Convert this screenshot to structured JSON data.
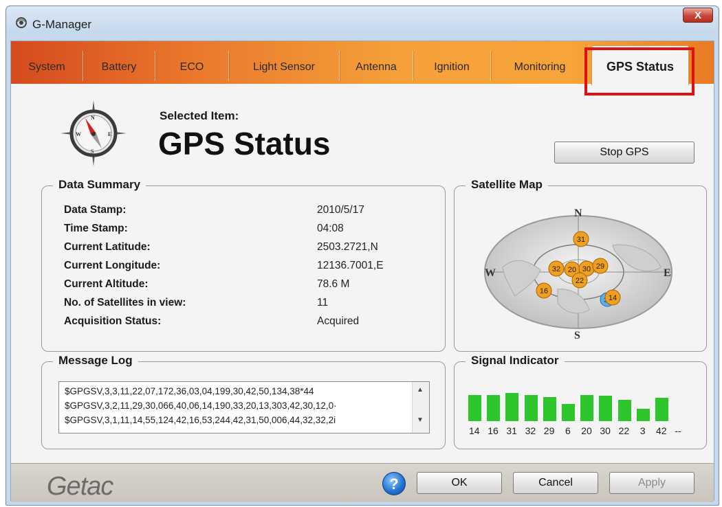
{
  "window": {
    "title": "G-Manager",
    "close_label": "X"
  },
  "tabs": [
    "System",
    "Battery",
    "ECO",
    "Light Sensor",
    "Antenna",
    "Ignition",
    "Monitoring",
    "GPS Status"
  ],
  "active_tab": "GPS Status",
  "header": {
    "selected_label": "Selected Item:",
    "title": "GPS Status",
    "stop_button": "Stop GPS"
  },
  "data_summary": {
    "title": "Data Summary",
    "rows": [
      {
        "label": "Data Stamp:",
        "value": "2010/5/17"
      },
      {
        "label": "Time Stamp:",
        "value": "04:08"
      },
      {
        "label": "Current Latitude:",
        "value": "2503.2721,N"
      },
      {
        "label": "Current Longitude:",
        "value": "12136.7001,E"
      },
      {
        "label": "Current Altitude:",
        "value": "78.6 M"
      },
      {
        "label": "No. of Satellites in view:",
        "value": "11"
      },
      {
        "label": "Acquisition Status:",
        "value": "Acquired"
      }
    ]
  },
  "satellite_map": {
    "title": "Satellite Map",
    "directions": {
      "n": "N",
      "s": "S",
      "e": "E",
      "w": "W"
    },
    "satellites": [
      "31",
      "32",
      "20",
      "30",
      "29",
      "22",
      "16",
      "14",
      "3"
    ]
  },
  "message_log": {
    "title": "Message Log",
    "lines": [
      "$GPGSV,3,3,11,22,07,172,36,03,04,199,30,42,50,134,38*44",
      "$GPGSV,3,2,11,29,30,066,40,06,14,190,33,20,13,303,42,30,12,0·",
      "$GPGSV,3,1,11,14,55,124,42,16,53,244,42,31,50,006,44,32,32,2i"
    ]
  },
  "signal_indicator": {
    "title": "Signal Indicator",
    "bars": [
      {
        "label": "14",
        "level": 0.8
      },
      {
        "label": "16",
        "level": 0.8
      },
      {
        "label": "31",
        "level": 0.85
      },
      {
        "label": "32",
        "level": 0.8
      },
      {
        "label": "29",
        "level": 0.72
      },
      {
        "label": "6",
        "level": 0.52
      },
      {
        "label": "20",
        "level": 0.8
      },
      {
        "label": "30",
        "level": 0.77
      },
      {
        "label": "22",
        "level": 0.64
      },
      {
        "label": "3",
        "level": 0.38
      },
      {
        "label": "42",
        "level": 0.7
      },
      {
        "label": "--",
        "level": 0
      }
    ],
    "bar_color": "#2cc52c"
  },
  "footer": {
    "brand": "Getac",
    "help_label": "?",
    "ok": "OK",
    "cancel": "Cancel",
    "apply": "Apply"
  },
  "colors": {
    "accent_orange": "#f5a03a",
    "highlight_red": "#e01010",
    "satellite_orange": "#f0a020",
    "satellite_blue": "#5bb0e8"
  }
}
